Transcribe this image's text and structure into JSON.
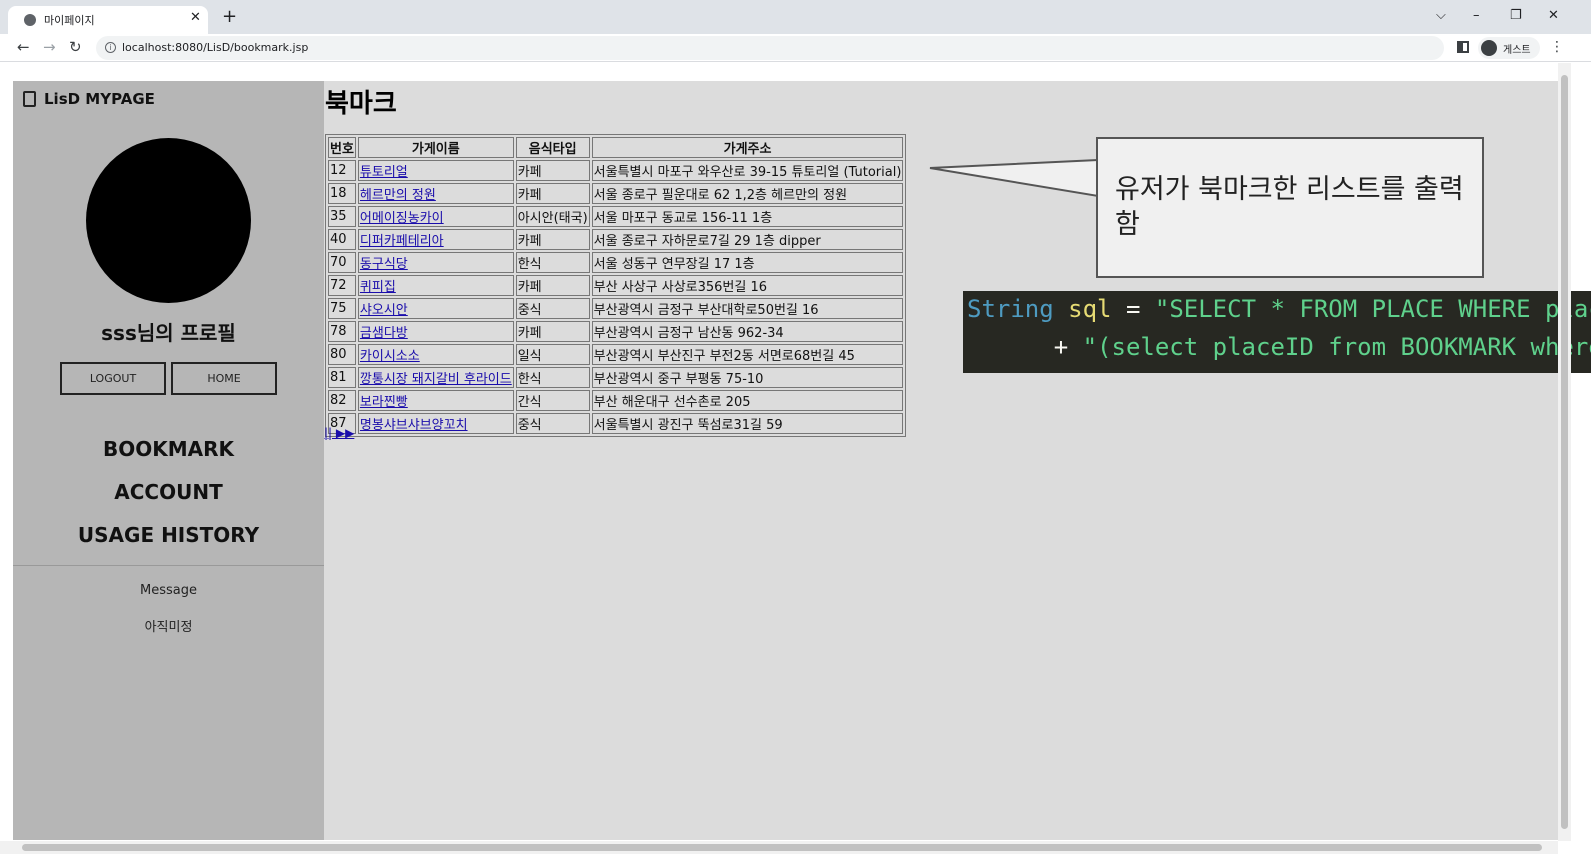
{
  "browser": {
    "tab_title": "마이페이지",
    "tab_close": "✕",
    "new_tab": "+",
    "url": "localhost:8080/LisD/bookmark.jsp",
    "profile_label": "게스트",
    "window_controls": {
      "dropdown": "⌵",
      "minimize": "–",
      "restore": "❐",
      "close": "✕"
    },
    "nav": {
      "back": "←",
      "forward": "→",
      "reload": "↻",
      "menu": "⋮",
      "info": "i"
    }
  },
  "sidebar": {
    "brand": "LisD MYPAGE",
    "profile_name": "sss님의 프로필",
    "buttons": {
      "logout": "LOGOUT",
      "home": "HOME"
    },
    "nav": [
      "BOOKMARK",
      "ACCOUNT",
      "USAGE HISTORY"
    ],
    "message_label": "Message",
    "message_value": "아직미정"
  },
  "main": {
    "title": "북마크",
    "table": {
      "headers": [
        "번호",
        "가게이름",
        "음식타입",
        "가게주소"
      ],
      "rows": [
        [
          "12",
          "튜토리얼",
          "카페",
          "서울특별시 마포구 와우산로 39-15 튜토리얼 (Tutorial)"
        ],
        [
          "18",
          "헤르만의 정원",
          "카페",
          "서울 종로구 필운대로 62 1,2층 헤르만의 정원"
        ],
        [
          "35",
          "어메이징농카이",
          "아시안(태국)",
          "서울 마포구 동교로 156-11 1층"
        ],
        [
          "40",
          "디퍼카페테리아",
          "카페",
          "서울 종로구 자하문로7길 29 1층 dipper"
        ],
        [
          "70",
          "동구식당",
          "한식",
          "서울 성동구 연무장길 17 1층"
        ],
        [
          "72",
          "퀴피집",
          "카페",
          "부산 사상구 사상로356번길 16"
        ],
        [
          "75",
          "샤오시안",
          "중식",
          "부산광역시 금정구 부산대학로50번길 16"
        ],
        [
          "78",
          "금샘다방",
          "카페",
          "부산광역시 금정구 남산동 962-34"
        ],
        [
          "80",
          "카이시소소",
          "일식",
          "부산광역시 부산진구 부전2동 서면로68번길 45"
        ],
        [
          "81",
          "깡통시장 돼지갈비 후라이드",
          "한식",
          "부산광역시 중구 부평동 75-10"
        ],
        [
          "82",
          "보라찐빵",
          "간식",
          "부산 해운대구 선수촌로 205"
        ],
        [
          "87",
          "명봉샤브샤브양꼬치",
          "중식",
          "서울특별시 광진구 뚝섬로31길 59"
        ]
      ]
    },
    "pager": "|| ▶▶",
    "callout": "유저가 북마크한 리스트를 출력함",
    "code": {
      "line1": {
        "type": "String",
        "var": "sql",
        "op": "=",
        "str": "\"SELECT * FROM PLACE WHERE placeID IN \""
      },
      "line2": {
        "op": "+",
        "str": "\"(select placeID from BOOKMARK where userID ="
      }
    }
  },
  "colors": {
    "page_bg": "#dcdcdc",
    "sidebar_bg": "#b6b6b6",
    "link": "#1a0dab",
    "code_bg": "#272822"
  }
}
